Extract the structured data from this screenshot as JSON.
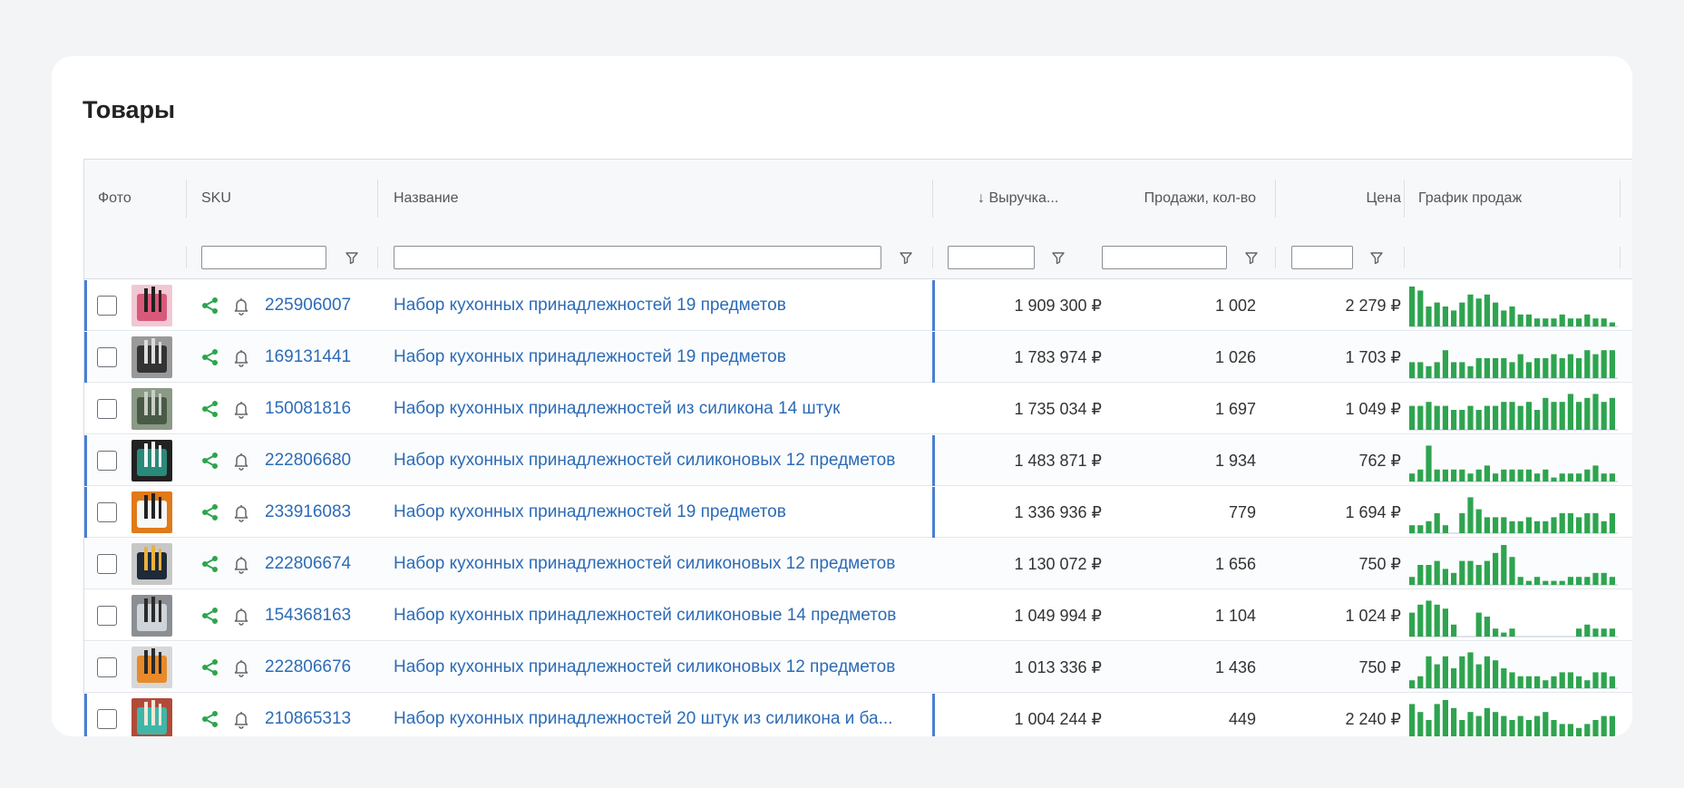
{
  "page": {
    "title": "Товары"
  },
  "columns": {
    "photo": "Фото",
    "sku": "SKU",
    "name": "Название",
    "revenue": "↓ Выручка...",
    "sales_qty": "Продажи, кол-во",
    "price": "Цена",
    "chart": "График продаж"
  },
  "colors": {
    "link": "#2c6bb6",
    "accent_green": "#2ea44f",
    "row_marker": "#4a7fd4"
  },
  "icons": {
    "share": "share-icon",
    "bell": "bell-icon",
    "filter": "filter-icon"
  },
  "rows": [
    {
      "sku": "225906007",
      "name": "Набор кухонных принадлежностей 19 предметов",
      "revenue": "1 909 300 ₽",
      "sales": "1 002",
      "price": "2 279 ₽",
      "marked": true,
      "spark": [
        10,
        9,
        5,
        6,
        5,
        4,
        6,
        8,
        7,
        8,
        6,
        4,
        5,
        3,
        3,
        2,
        2,
        2,
        3,
        2,
        2,
        3,
        2,
        2,
        1
      ]
    },
    {
      "sku": "169131441",
      "name": "Набор кухонных принадлежностей 19 предметов",
      "revenue": "1 783 974 ₽",
      "sales": "1 026",
      "price": "1 703 ₽",
      "marked": true,
      "spark": [
        4,
        4,
        3,
        4,
        7,
        4,
        4,
        3,
        5,
        5,
        5,
        5,
        4,
        6,
        4,
        5,
        5,
        6,
        5,
        6,
        5,
        7,
        6,
        7,
        7
      ]
    },
    {
      "sku": "150081816",
      "name": "Набор кухонных принадлежностей из силикона 14 штук",
      "revenue": "1 735 034 ₽",
      "sales": "1 697",
      "price": "1 049 ₽",
      "marked": false,
      "spark": [
        6,
        6,
        7,
        6,
        6,
        5,
        5,
        6,
        5,
        6,
        6,
        7,
        7,
        6,
        7,
        5,
        8,
        7,
        7,
        9,
        7,
        8,
        9,
        7,
        8
      ]
    },
    {
      "sku": "222806680",
      "name": "Набор кухонных принадлежностей силиконовых 12 предметов",
      "revenue": "1 483 871 ₽",
      "sales": "1 934",
      "price": "762 ₽",
      "marked": true,
      "spark": [
        2,
        3,
        9,
        3,
        3,
        3,
        3,
        2,
        3,
        4,
        2,
        3,
        3,
        3,
        3,
        2,
        3,
        1,
        2,
        2,
        2,
        3,
        4,
        2,
        2
      ]
    },
    {
      "sku": "233916083",
      "name": "Набор кухонных принадлежностей 19 предметов",
      "revenue": "1 336 936 ₽",
      "sales": "779",
      "price": "1 694 ₽",
      "marked": true,
      "spark": [
        2,
        2,
        3,
        5,
        2,
        0,
        5,
        9,
        6,
        4,
        4,
        4,
        3,
        3,
        4,
        3,
        3,
        4,
        5,
        5,
        4,
        5,
        5,
        3,
        5
      ]
    },
    {
      "sku": "222806674",
      "name": "Набор кухонных принадлежностей силиконовых 12 предметов",
      "revenue": "1 130 072 ₽",
      "sales": "1 656",
      "price": "750 ₽",
      "marked": false,
      "spark": [
        2,
        5,
        5,
        6,
        4,
        3,
        6,
        6,
        5,
        6,
        8,
        10,
        7,
        2,
        1,
        2,
        1,
        1,
        1,
        2,
        2,
        2,
        3,
        3,
        2
      ]
    },
    {
      "sku": "154368163",
      "name": "Набор кухонных принадлежностей силиконовые 14 предметов",
      "revenue": "1 049 994 ₽",
      "sales": "1 104",
      "price": "1 024 ₽",
      "marked": false,
      "spark": [
        6,
        8,
        9,
        8,
        7,
        3,
        0,
        0,
        6,
        5,
        2,
        1,
        2,
        0,
        0,
        0,
        0,
        0,
        0,
        0,
        2,
        3,
        2,
        2,
        2
      ]
    },
    {
      "sku": "222806676",
      "name": "Набор кухонных принадлежностей силиконовых 12 предметов",
      "revenue": "1 013 336 ₽",
      "sales": "1 436",
      "price": "750 ₽",
      "marked": false,
      "spark": [
        2,
        3,
        8,
        6,
        8,
        5,
        8,
        9,
        6,
        8,
        7,
        5,
        4,
        3,
        3,
        3,
        2,
        3,
        4,
        4,
        3,
        2,
        4,
        4,
        3
      ]
    },
    {
      "sku": "210865313",
      "name": "Набор кухонных принадлежностей 20 штук из силикона и ба...",
      "revenue": "1 004 244 ₽",
      "sales": "449",
      "price": "2 240 ₽",
      "marked": true,
      "spark": [
        9,
        7,
        5,
        9,
        10,
        8,
        5,
        7,
        6,
        8,
        7,
        6,
        5,
        6,
        5,
        6,
        7,
        5,
        4,
        4,
        3,
        4,
        5,
        6,
        6
      ]
    }
  ]
}
